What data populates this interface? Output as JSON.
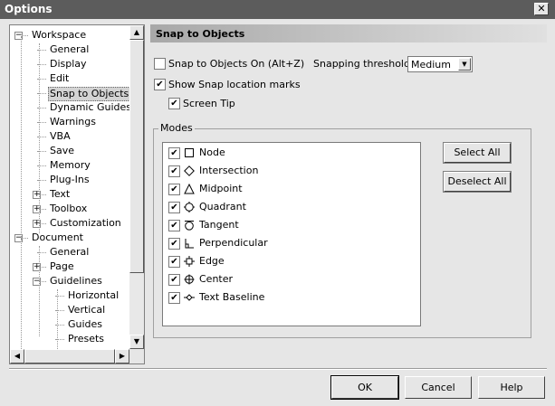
{
  "window": {
    "title": "Options",
    "close_glyph": "✕"
  },
  "tree": {
    "items": [
      {
        "label": "Workspace",
        "level": 0,
        "expander": "−"
      },
      {
        "label": "General",
        "level": 1
      },
      {
        "label": "Display",
        "level": 1
      },
      {
        "label": "Edit",
        "level": 1
      },
      {
        "label": "Snap to Objects",
        "level": 1,
        "selected": true
      },
      {
        "label": "Dynamic Guides",
        "level": 1
      },
      {
        "label": "Warnings",
        "level": 1
      },
      {
        "label": "VBA",
        "level": 1
      },
      {
        "label": "Save",
        "level": 1
      },
      {
        "label": "Memory",
        "level": 1
      },
      {
        "label": "Plug-Ins",
        "level": 1
      },
      {
        "label": "Text",
        "level": 1,
        "expander": "+"
      },
      {
        "label": "Toolbox",
        "level": 1,
        "expander": "+"
      },
      {
        "label": "Customization",
        "level": 1,
        "expander": "+"
      },
      {
        "label": "Document",
        "level": 0,
        "expander": "−"
      },
      {
        "label": "General",
        "level": 1
      },
      {
        "label": "Page",
        "level": 1,
        "expander": "+"
      },
      {
        "label": "Guidelines",
        "level": 1,
        "expander": "−"
      },
      {
        "label": "Horizontal",
        "level": 2
      },
      {
        "label": "Vertical",
        "level": 2
      },
      {
        "label": "Guides",
        "level": 2
      },
      {
        "label": "Presets",
        "level": 2
      }
    ]
  },
  "panel": {
    "title": "Snap to Objects",
    "snap_on_label": "Snap to Objects On (Alt+Z)",
    "snap_on_checked": false,
    "threshold_label": "Snapping threshold",
    "threshold_value": "Medium",
    "show_marks_label": "Show Snap location marks",
    "show_marks_checked": true,
    "screen_tip_label": "Screen Tip",
    "screen_tip_checked": true,
    "modes_label": "Modes",
    "modes": [
      {
        "label": "Node",
        "icon": "square-icon",
        "checked": true
      },
      {
        "label": "Intersection",
        "icon": "diamond-icon",
        "checked": true
      },
      {
        "label": "Midpoint",
        "icon": "triangle-icon",
        "checked": true
      },
      {
        "label": "Quadrant",
        "icon": "quadrant-circle-icon",
        "checked": true
      },
      {
        "label": "Tangent",
        "icon": "tangent-circle-icon",
        "checked": true
      },
      {
        "label": "Perpendicular",
        "icon": "perpendicular-icon",
        "checked": true
      },
      {
        "label": "Edge",
        "icon": "edge-icon",
        "checked": true
      },
      {
        "label": "Center",
        "icon": "center-crosshair-icon",
        "checked": true
      },
      {
        "label": "Text Baseline",
        "icon": "text-baseline-icon",
        "checked": true
      }
    ],
    "select_all": "Select All",
    "deselect_all": "Deselect All"
  },
  "footer": {
    "ok": "OK",
    "cancel": "Cancel",
    "help": "Help"
  },
  "check_glyph": "✔"
}
